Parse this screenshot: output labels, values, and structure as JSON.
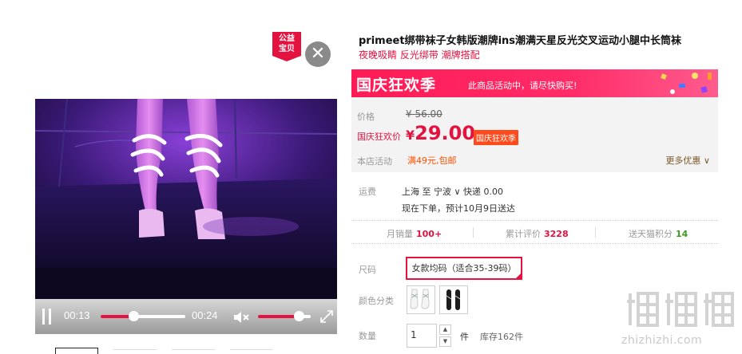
{
  "badge": {
    "line1": "公益",
    "line2": "宝贝"
  },
  "close_glyph": "✕",
  "video": {
    "current_time": "00:13",
    "duration": "00:24",
    "progress": 0.39,
    "volume": 0.78
  },
  "product": {
    "title": "primeet绑带袜子女韩版潮牌ins潮满天星反光交叉运动小腿中长筒袜",
    "subtitle": "夜晚吸睛 反光绑带 潮牌搭配"
  },
  "banner": {
    "logo": "国庆狂欢季",
    "text": "此商品活动中，请尽快购买!"
  },
  "price": {
    "label": "价格",
    "original": "¥ 56.00",
    "sale_label": "国庆狂欢价",
    "sale_currency": "¥",
    "sale_value": "29.00",
    "sale_tag": "国庆狂欢季",
    "promo_label": "本店活动",
    "promo_text": "满49元,包邮",
    "more": "更多优惠"
  },
  "shipping": {
    "label": "运费",
    "line1": "上海  至 宁波 ∨  快递 0.00",
    "line2": "现在下单，预计10月9日送达"
  },
  "stats": [
    {
      "label": "月销量",
      "value": "100+",
      "color": "#e4123f"
    },
    {
      "label": "累计评价",
      "value": "3228",
      "color": "#e4123f"
    },
    {
      "label": "送天猫积分",
      "value": "14",
      "color": "#3a9b20"
    }
  ],
  "options": {
    "size_label": "尺码",
    "size_value": "女款均码（适合35-39码）",
    "color_label": "颜色分类",
    "qty_label": "数量",
    "qty_value": "1",
    "qty_unit": "件",
    "stock": "库存162件"
  },
  "watermark": {
    "logo": "值值值",
    "url": "zhizhizhi.com"
  },
  "colors": {
    "accent": "#e4123f",
    "banner": "#ff1a55",
    "promo": "#ff5100"
  }
}
